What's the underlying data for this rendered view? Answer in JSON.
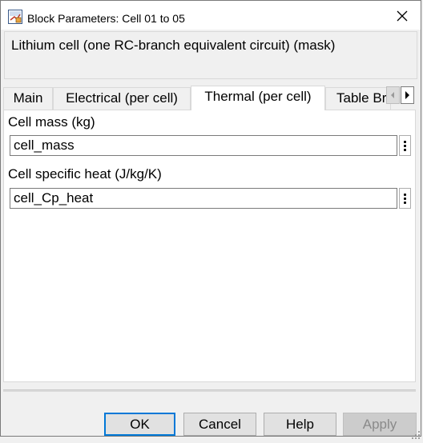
{
  "window": {
    "title": "Block Parameters: Cell 01 to 05"
  },
  "description": {
    "text": "Lithium cell (one RC-branch equivalent circuit) (mask)"
  },
  "tabs": [
    {
      "label": "Main",
      "active": false
    },
    {
      "label": "Electrical (per cell)",
      "active": false
    },
    {
      "label": "Thermal (per cell)",
      "active": true
    },
    {
      "label": "Table Br",
      "active": false
    }
  ],
  "fields": [
    {
      "label": "Cell mass (kg)",
      "value": "cell_mass"
    },
    {
      "label": "Cell specific heat (J/kg/K)",
      "value": "cell_Cp_heat"
    }
  ],
  "buttons": {
    "ok": "OK",
    "cancel": "Cancel",
    "help": "Help",
    "apply": "Apply"
  },
  "colors": {
    "accent": "#0078d7",
    "panel_bg": "#ffffff",
    "dialog_bg": "#f0f0f0"
  }
}
